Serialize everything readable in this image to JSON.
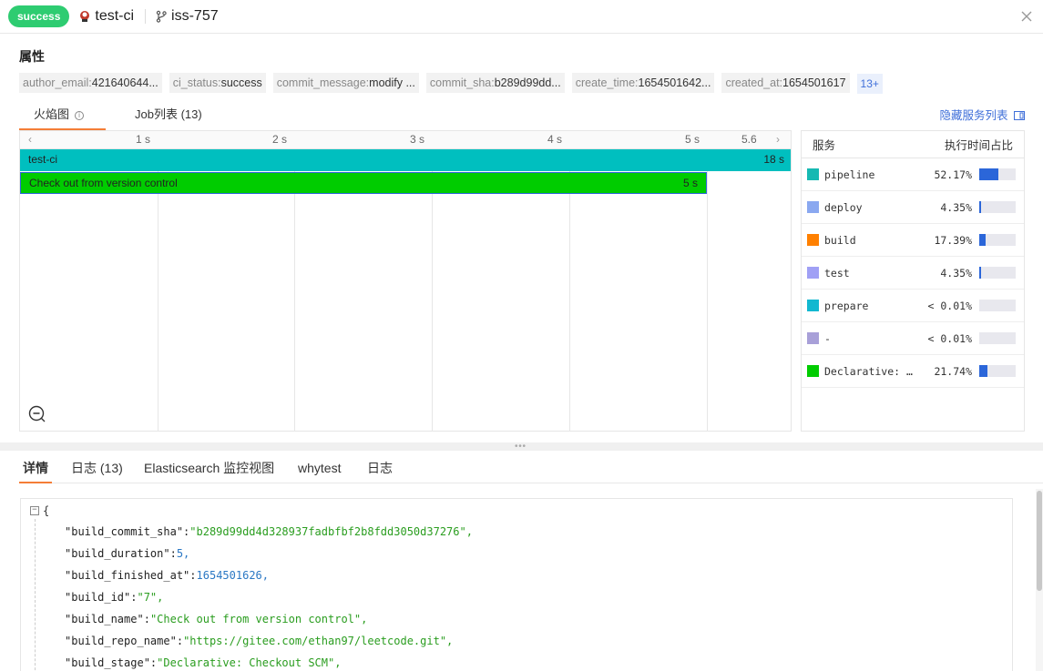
{
  "header": {
    "status": "success",
    "service_name": "test-ci",
    "branch": "iss-757"
  },
  "attributes": {
    "title": "属性",
    "tags": [
      {
        "key": "author_email:",
        "value": "421640644..."
      },
      {
        "key": "ci_status:",
        "value": "success"
      },
      {
        "key": "commit_message:",
        "value": "modify ..."
      },
      {
        "key": "commit_sha:",
        "value": "b289d99dd..."
      },
      {
        "key": "create_time:",
        "value": "1654501642..."
      },
      {
        "key": "created_at:",
        "value": "1654501617"
      }
    ],
    "more": "13+"
  },
  "view_tabs": {
    "flame": "火焰图",
    "jobs": "Job列表 (13)",
    "hide_services": "隐藏服务列表"
  },
  "flame": {
    "ticks": [
      "1 s",
      "2 s",
      "3 s",
      "4 s",
      "5 s",
      "5.6"
    ],
    "spans": [
      {
        "name": "test-ci",
        "duration": "18 s",
        "color": "#00bfbf"
      },
      {
        "name": "Check out from version control",
        "duration": "5 s",
        "color": "#00cc00"
      }
    ]
  },
  "services": {
    "header_name": "服务",
    "header_pct": "执行时间占比",
    "rows": [
      {
        "name": "pipeline",
        "pct": "52.17%",
        "fill": 0.5217,
        "color": "#16b9b2"
      },
      {
        "name": "deploy",
        "pct": "4.35%",
        "fill": 0.0435,
        "color": "#8aa8f0"
      },
      {
        "name": "build",
        "pct": "17.39%",
        "fill": 0.1739,
        "color": "#ff8000"
      },
      {
        "name": "test",
        "pct": "4.35%",
        "fill": 0.0435,
        "color": "#a0a0f5"
      },
      {
        "name": "prepare",
        "pct": "< 0.01%",
        "fill": 0,
        "color": "#12b8d0"
      },
      {
        "name": "-",
        "pct": "< 0.01%",
        "fill": 0,
        "color": "#a8a0d8"
      },
      {
        "name": "Declarative: …",
        "pct": "21.74%",
        "fill": 0.2174,
        "color": "#00cc00"
      }
    ]
  },
  "detail_tabs": [
    "详情",
    "日志 (13)",
    "Elasticsearch 监控视图",
    "whytest",
    "日志"
  ],
  "json": {
    "open_brace": "{",
    "lines": [
      {
        "key": "\"build_commit_sha\"",
        "value": "\"b289d99dd4d328937fadbfbf2b8fdd3050d37276\",",
        "type": "string"
      },
      {
        "key": "\"build_duration\"",
        "value": "5,",
        "type": "number"
      },
      {
        "key": "\"build_finished_at\"",
        "value": "1654501626,",
        "type": "number"
      },
      {
        "key": "\"build_id\"",
        "value": "\"7\",",
        "type": "string"
      },
      {
        "key": "\"build_name\"",
        "value": "\"Check out from version control\",",
        "type": "string"
      },
      {
        "key": "\"build_repo_name\"",
        "value": "\"https://gitee.com/ethan97/leetcode.git\",",
        "type": "string"
      },
      {
        "key": "\"build_stage\"",
        "value": "\"Declarative: Checkout SCM\",",
        "type": "string"
      }
    ]
  }
}
